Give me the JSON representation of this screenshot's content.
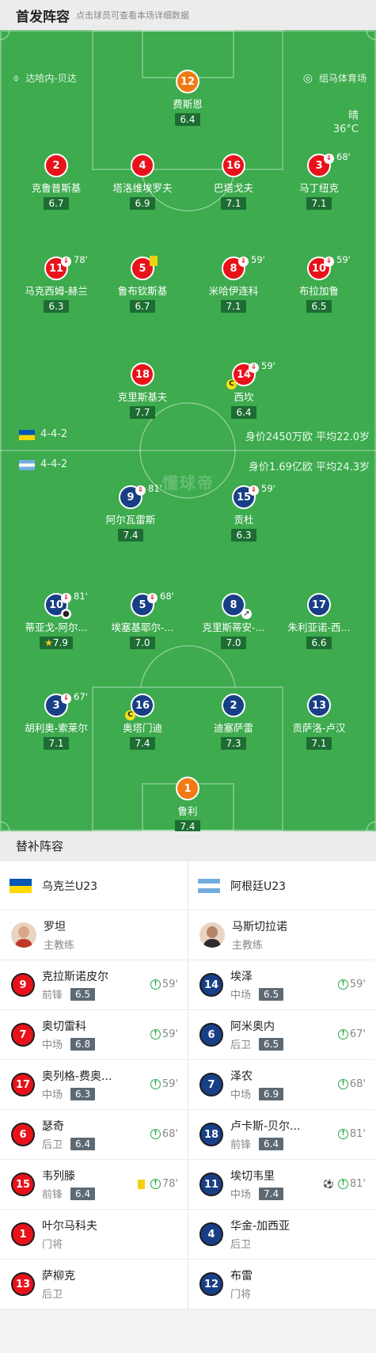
{
  "header": {
    "title": "首发阵容",
    "subtitle": "点击球员可查看本场详细数据"
  },
  "pitch": {
    "referee": "达哈内-贝达",
    "stadium": "组马体育场",
    "weather": "晴",
    "temperature": "36°C",
    "watermark": "懂球帝",
    "home_formation": {
      "form": "4-4-2",
      "value": "身价2450万欧  平均22.0岁"
    },
    "away_formation": {
      "form": "4-4-2",
      "value": "身价1.69亿欧  平均24.3岁"
    }
  },
  "home_players": [
    {
      "num": "12",
      "name": "费斯恩",
      "rating": "6.4"
    },
    {
      "num": "2",
      "name": "克鲁普斯基",
      "rating": "6.7"
    },
    {
      "num": "4",
      "name": "塔洛维埃罗夫",
      "rating": "6.9"
    },
    {
      "num": "16",
      "name": "巴塔戈夫",
      "rating": "7.1"
    },
    {
      "num": "3",
      "name": "马丁纽克",
      "rating": "7.1",
      "sub": "68'"
    },
    {
      "num": "11",
      "name": "马克西姆-赫兰",
      "rating": "6.3",
      "sub": "78'"
    },
    {
      "num": "5",
      "name": "鲁布钦斯基",
      "rating": "6.7"
    },
    {
      "num": "8",
      "name": "米哈伊连科",
      "rating": "7.1",
      "sub": "59'"
    },
    {
      "num": "10",
      "name": "布拉加鲁",
      "rating": "6.5",
      "sub": "59'"
    },
    {
      "num": "18",
      "name": "克里斯基夫",
      "rating": "7.7"
    },
    {
      "num": "14",
      "name": "西坎",
      "rating": "6.4",
      "sub": "59'"
    }
  ],
  "away_players": [
    {
      "num": "9",
      "name": "阿尔瓦雷斯",
      "rating": "7.4",
      "sub": "81'"
    },
    {
      "num": "15",
      "name": "贡杜",
      "rating": "6.3",
      "sub": "59'"
    },
    {
      "num": "10",
      "name": "蒂亚戈-阿尔...",
      "rating": "7.9",
      "sub": "81'"
    },
    {
      "num": "5",
      "name": "埃塞基耶尔-...",
      "rating": "7.0",
      "sub": "68'"
    },
    {
      "num": "8",
      "name": "克里斯蒂安-...",
      "rating": "7.0"
    },
    {
      "num": "17",
      "name": "朱利亚诺-西...",
      "rating": "6.6"
    },
    {
      "num": "3",
      "name": "胡利奥-索莱尔",
      "rating": "7.1",
      "sub": "67'"
    },
    {
      "num": "16",
      "name": "奥塔门迪",
      "rating": "7.4"
    },
    {
      "num": "2",
      "name": "迪塞萨雷",
      "rating": "7.3"
    },
    {
      "num": "13",
      "name": "贡萨洛-卢汉",
      "rating": "7.1"
    },
    {
      "num": "1",
      "name": "鲁利",
      "rating": "7.4"
    }
  ],
  "subs": {
    "title": "替补阵容",
    "home_team": "乌克兰U23",
    "away_team": "阿根廷U23",
    "home_coach": {
      "name": "罗坦",
      "role": "主教练"
    },
    "away_coach": {
      "name": "马斯切拉诺",
      "role": "主教练"
    },
    "home": [
      {
        "num": "9",
        "name": "克拉斯诺皮尔",
        "pos": "前锋",
        "rating": "6.5",
        "in": "59'"
      },
      {
        "num": "7",
        "name": "奥切雷科",
        "pos": "中场",
        "rating": "6.8",
        "in": "59'"
      },
      {
        "num": "17",
        "name": "奥列格-费奥...",
        "pos": "中场",
        "rating": "6.3",
        "in": "59'"
      },
      {
        "num": "6",
        "name": "瑟奇",
        "pos": "后卫",
        "rating": "6.4",
        "in": "68'"
      },
      {
        "num": "15",
        "name": "韦列滕",
        "pos": "前锋",
        "rating": "6.4",
        "in": "78'"
      },
      {
        "num": "1",
        "name": "叶尔马科夫",
        "pos": "门将"
      },
      {
        "num": "13",
        "name": "萨柳克",
        "pos": "后卫"
      }
    ],
    "away": [
      {
        "num": "14",
        "name": "埃泽",
        "pos": "中场",
        "rating": "6.5",
        "in": "59'"
      },
      {
        "num": "6",
        "name": "阿米奥内",
        "pos": "后卫",
        "rating": "6.5",
        "in": "67'"
      },
      {
        "num": "7",
        "name": "泽农",
        "pos": "中场",
        "rating": "6.9",
        "in": "68'"
      },
      {
        "num": "18",
        "name": "卢卡斯-贝尔...",
        "pos": "前锋",
        "rating": "6.4",
        "in": "81'"
      },
      {
        "num": "11",
        "name": "埃切韦里",
        "pos": "中场",
        "rating": "7.4",
        "in": "81'"
      },
      {
        "num": "4",
        "name": "华金-加西亚",
        "pos": "后卫"
      },
      {
        "num": "12",
        "name": "布雷",
        "pos": "门将"
      }
    ]
  },
  "icons": {
    "whistle": "whistle-icon",
    "stadium": "stadium-icon",
    "sub_out": "sub-out-icon",
    "sub_in": "sub-in-icon",
    "captain": "C",
    "yellow": "#f2d012",
    "red": "#e8121b",
    "navy": "#183f86"
  }
}
